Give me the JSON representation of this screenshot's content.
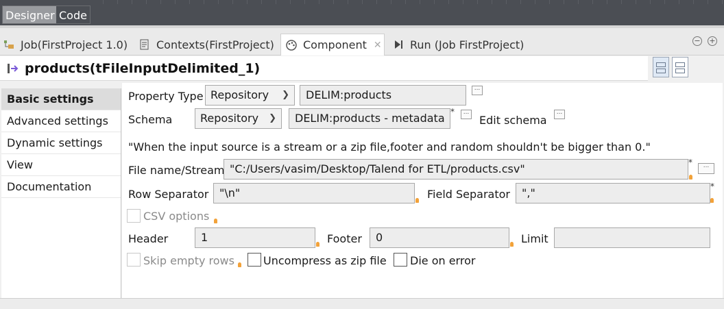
{
  "top": {
    "designer_tab": "Designer",
    "code_tab": "Code"
  },
  "view_tabs": [
    {
      "label": "Job(FirstProject 1.0)",
      "icon": "job-icon"
    },
    {
      "label": "Contexts(FirstProject)",
      "icon": "contexts-icon"
    },
    {
      "label": "Component",
      "icon": "palette-icon",
      "close": "✕"
    },
    {
      "label": "Run (Job FirstProject)",
      "icon": "run-icon"
    }
  ],
  "component": {
    "title": "products(tFileInputDelimited_1)"
  },
  "nav": {
    "items": [
      "Basic settings",
      "Advanced settings",
      "Dynamic settings",
      "View",
      "Documentation"
    ]
  },
  "settings": {
    "property_type_label": "Property Type",
    "property_type_value": "Repository",
    "property_repo": "DELIM:products",
    "schema_label": "Schema",
    "schema_value": "Repository",
    "schema_repo": "DELIM:products - metadata",
    "edit_schema_label": "Edit schema",
    "warning": "\"When the input source is a stream or a zip file,footer and random shouldn't be bigger than 0.\"",
    "filename_label": "File name/Stream",
    "filename_value": "\"C:/Users/vasim/Desktop/Talend for ETL/products.csv\"",
    "row_sep_label": "Row Separator",
    "row_sep_value": "\"\\n\"",
    "field_sep_label": "Field Separator",
    "field_sep_value": "\",\"",
    "csv_options_label": "CSV options",
    "header_label": "Header",
    "header_value": "1",
    "footer_label": "Footer",
    "footer_value": "0",
    "limit_label": "Limit",
    "limit_value": "",
    "skip_empty_label": "Skip empty rows",
    "uncompress_label": "Uncompress as zip file",
    "die_on_error_label": "Die on error",
    "required_mark": "*",
    "more_button": "..."
  }
}
